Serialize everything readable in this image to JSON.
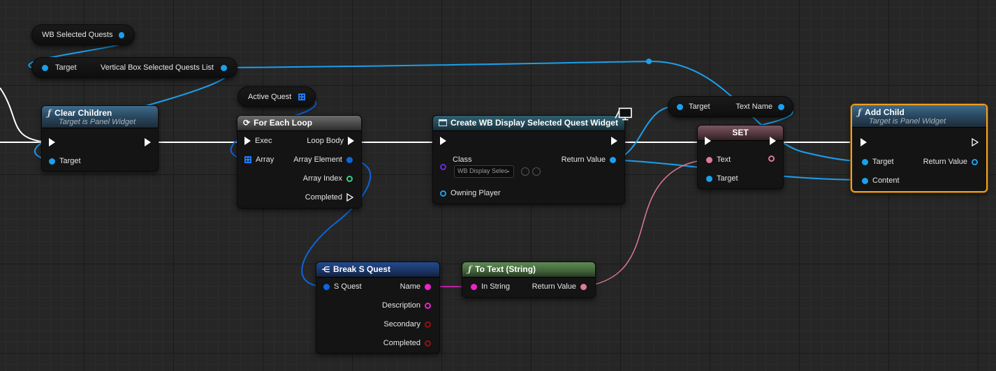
{
  "nodes": {
    "wb_selected_quests": {
      "label": "WB Selected Quests"
    },
    "vertical_box": {
      "target_label": "Target",
      "output_label": "Vertical Box Selected Quests List"
    },
    "clear_children": {
      "title": "Clear Children",
      "subtitle": "Target is Panel Widget",
      "target_label": "Target"
    },
    "active_quest": {
      "label": "Active Quest"
    },
    "for_each_loop": {
      "title": "For Each Loop",
      "exec_label": "Exec",
      "array_label": "Array",
      "loop_body_label": "Loop Body",
      "array_element_label": "Array Element",
      "array_index_label": "Array Index",
      "completed_label": "Completed"
    },
    "create_widget": {
      "title": "Create WB Display Selected Quest Widget",
      "class_label": "Class",
      "class_value": "WB Display Selec",
      "owning_player_label": "Owning Player",
      "return_value_label": "Return Value"
    },
    "text_name_getter": {
      "target_label": "Target",
      "output_label": "Text Name"
    },
    "set_node": {
      "title": "SET",
      "text_label": "Text",
      "target_label": "Target"
    },
    "add_child": {
      "title": "Add Child",
      "subtitle": "Target is Panel Widget",
      "target_label": "Target",
      "content_label": "Content",
      "return_value_label": "Return Value"
    },
    "break_s_quest": {
      "title": "Break S Quest",
      "input_label": "S Quest",
      "name_label": "Name",
      "description_label": "Description",
      "secondary_label": "Secondary",
      "completed_label": "Completed"
    },
    "to_text": {
      "title": "To Text (String)",
      "input_label": "In String",
      "return_value_label": "Return Value"
    }
  },
  "colors": {
    "background": "#262626",
    "exec_wire": "#ffffff",
    "object_wire": "#1aa0ee",
    "string_wire": "#ee22cc",
    "text_wire": "#e07a95",
    "struct_wire": "#0a66dd",
    "selected_outline": "#f0a020"
  },
  "icons": [
    "function-icon",
    "loop-icon",
    "widget-icon",
    "break-struct-icon",
    "array-icon",
    "search-icon",
    "browse-icon",
    "monitor-icon",
    "dropdown-chevron-icon"
  ]
}
